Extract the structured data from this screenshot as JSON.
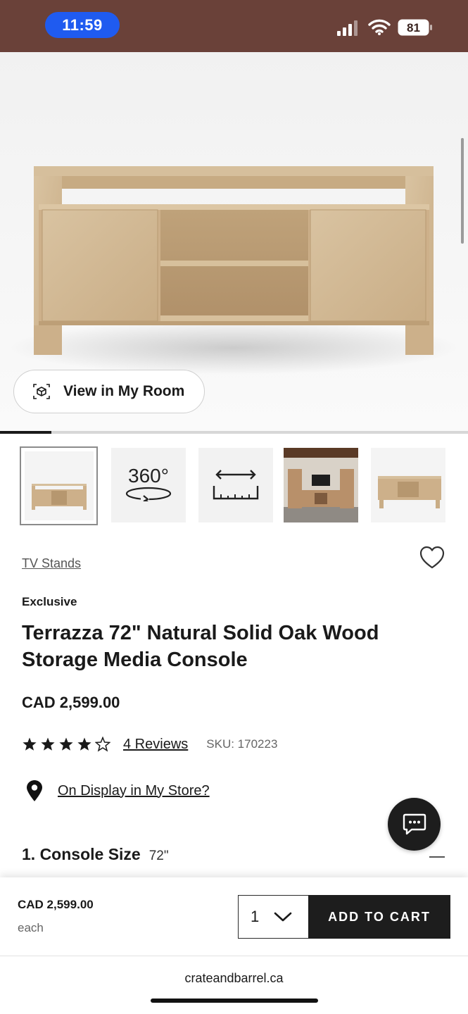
{
  "status_bar": {
    "time": "11:59",
    "battery": "81",
    "colors": {
      "background": "#6a4139",
      "time_pill": "#1f5bf0"
    }
  },
  "gallery": {
    "view_in_room_label": "View in My Room",
    "image_progress": 0.11,
    "thumbnails": [
      {
        "name": "front-view",
        "selected": true
      },
      {
        "name": "360-view",
        "label": "360°"
      },
      {
        "name": "dimensions-view"
      },
      {
        "name": "room-scene"
      },
      {
        "name": "side-view"
      }
    ]
  },
  "product": {
    "category": "TV Stands",
    "badge": "Exclusive",
    "title": "Terrazza 72\" Natural Solid Oak Wood Storage Media Console",
    "price": "CAD 2,599.00",
    "rating": 4,
    "rating_max": 5,
    "reviews_label": "4 Reviews",
    "sku": "SKU: 170223",
    "store_link": "On Display in My Store?",
    "option": {
      "label": "1. Console Size",
      "value": "72\""
    }
  },
  "cart_bar": {
    "price": "CAD 2,599.00",
    "unit": "each",
    "quantity": "1",
    "add_button": "ADD TO CART"
  },
  "browser": {
    "url": "crateandbarrel.ca"
  },
  "icons": [
    "signal-icon",
    "wifi-icon",
    "battery-icon",
    "ar-cube-icon",
    "heart-icon",
    "star-icon",
    "location-pin-icon",
    "chat-icon",
    "chevron-down-icon",
    "ruler-icon",
    "rotate-icon"
  ]
}
